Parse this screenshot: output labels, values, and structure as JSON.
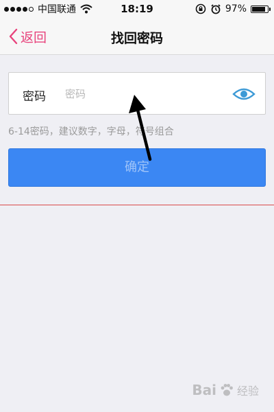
{
  "status_bar": {
    "carrier": "中国联通",
    "time": "18:19",
    "battery": "97%",
    "battery_level": 0.97,
    "signal_bars_filled": 4,
    "signal_bars_total": 5,
    "icons": [
      "signal-dots-icon",
      "wifi-icon",
      "rotation-lock-icon",
      "alarm-icon",
      "battery-icon"
    ]
  },
  "nav": {
    "back_label": "返回",
    "title": "找回密码"
  },
  "password_field": {
    "label": "密码",
    "placeholder": "密码",
    "value": ""
  },
  "hint": "6-14密码，建议数字，字母，符号组合",
  "confirm_button": {
    "label": "确定"
  },
  "watermark": {
    "logo_text": "Bai",
    "sub_text": "经验"
  },
  "colors": {
    "accent_pink": "#e8437c",
    "primary_blue": "#3b87f3",
    "eye_icon_blue": "#3d9ad6",
    "divider_red": "#d94a4a",
    "background": "#efeff4"
  }
}
